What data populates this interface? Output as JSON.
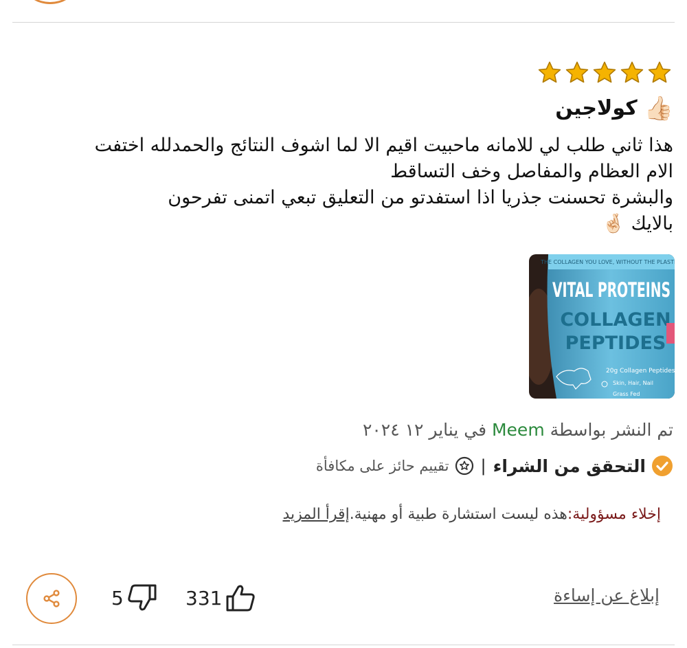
{
  "review": {
    "rating": 5,
    "rating_max": 5,
    "star_color": "#f5b301",
    "title": "كولاجين",
    "title_emoji": "👍🏻",
    "body_lines": [
      "هذا ثاني طلب لي للامانه ماحبيت اقيم الا لما اشوف النتائج والحمدلله اختفت",
      "الام العظام والمفاصل وخف التساقط",
      "والبشرة تحسنت جذريا اذا استفدتو من التعليق تبعي اتمنى تفرحون",
      "بالايك"
    ],
    "body_end_emoji": "🤞🏻",
    "photo": {
      "arc_text": "THE COLLAGEN YOU LOVE, WITHOUT THE PLASTIC",
      "brand": "VITAL PROTEINS",
      "product_line1": "COLLAGEN",
      "product_line2": "PEPTIDES",
      "detail1": "20g Collagen Peptides",
      "detail2": "Skin, Hair, Nail",
      "detail3": "Grass Fed"
    },
    "posted_prefix": "تم النشر بواسطة",
    "author": "Meem",
    "posted_date": "في يناير ١٢ ٢٠٢٤",
    "verified_label": "التحقق من الشراء",
    "separator": "|",
    "award_label": "تقييم حائز على مكافأة",
    "disclaimer_label": "إخلاء مسؤولية:",
    "disclaimer_text": "هذه ليست استشارة طبية أو مهنية.",
    "read_more": "إقرأ المزيد"
  },
  "actions": {
    "report": "إبلاغ عن إساءة",
    "helpful_count": "331",
    "unhelpful_count": "5"
  },
  "colors": {
    "accent_orange": "#e08a3c",
    "author_green": "#2c8a3d",
    "disclaimer_red": "#7a1a1a"
  }
}
